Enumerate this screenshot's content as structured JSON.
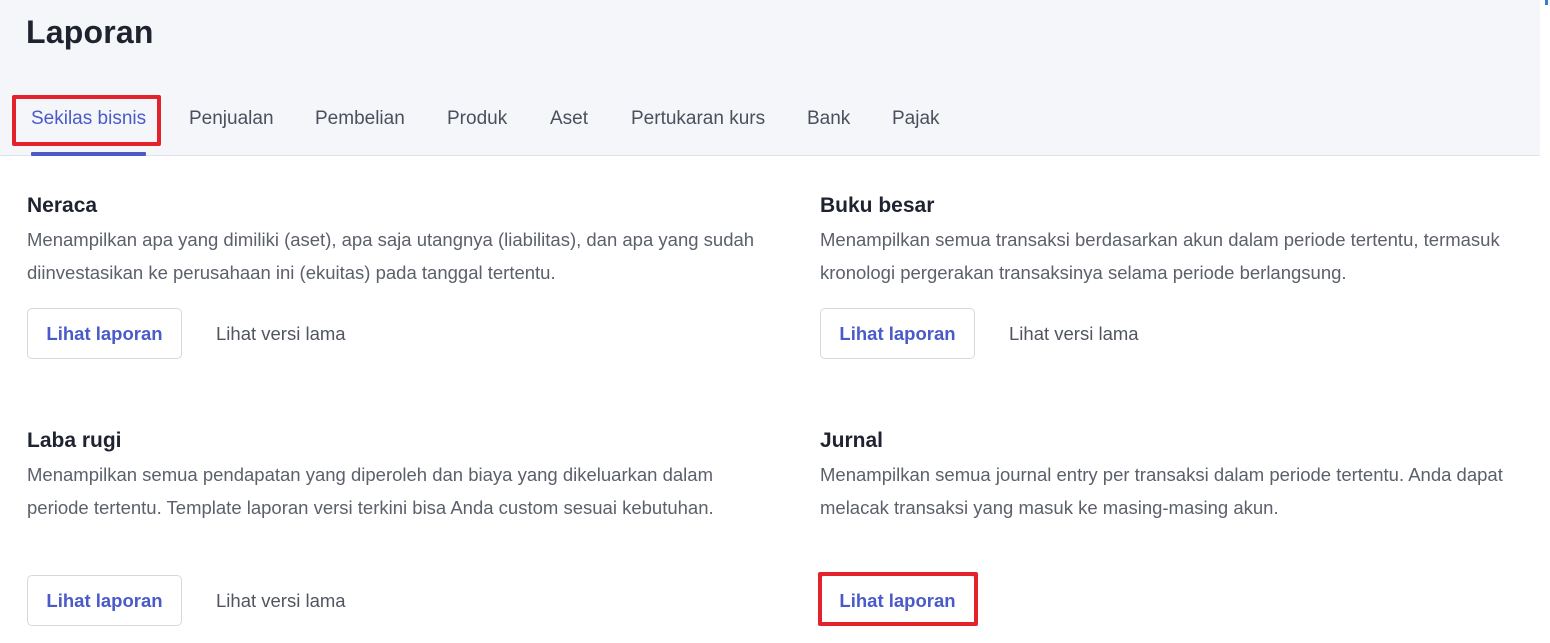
{
  "header": {
    "title": "Laporan"
  },
  "tabs": [
    {
      "label": "Sekilas bisnis",
      "active": true
    },
    {
      "label": "Penjualan",
      "active": false
    },
    {
      "label": "Pembelian",
      "active": false
    },
    {
      "label": "Produk",
      "active": false
    },
    {
      "label": "Aset",
      "active": false
    },
    {
      "label": "Pertukaran kurs",
      "active": false
    },
    {
      "label": "Bank",
      "active": false
    },
    {
      "label": "Pajak",
      "active": false
    }
  ],
  "reports": [
    {
      "title": "Neraca",
      "description": "Menampilkan apa yang dimiliki (aset), apa saja utangnya (liabilitas), dan apa yang sudah diinvestasikan ke perusahaan ini (ekuitas) pada tanggal tertentu.",
      "view_label": "Lihat laporan",
      "old_label": "Lihat versi lama"
    },
    {
      "title": "Buku besar",
      "description": "Menampilkan semua transaksi berdasarkan akun dalam periode tertentu, termasuk kronologi pergerakan transaksinya selama periode berlangsung.",
      "view_label": "Lihat laporan",
      "old_label": "Lihat versi lama"
    },
    {
      "title": "Laba rugi",
      "description": "Menampilkan semua pendapatan yang diperoleh dan biaya yang dikeluarkan dalam periode tertentu. Template laporan versi terkini bisa Anda custom sesuai kebutuhan.",
      "view_label": "Lihat laporan",
      "old_label": "Lihat versi lama"
    },
    {
      "title": "Jurnal",
      "description": "Menampilkan semua journal entry per transaksi dalam periode tertentu. Anda dapat melacak transaksi yang masuk ke masing-masing akun.",
      "view_label": "Lihat laporan"
    }
  ],
  "colors": {
    "accent": "#4a5bc9",
    "highlight": "#e4222c",
    "header_bg": "#f4f6fa"
  }
}
